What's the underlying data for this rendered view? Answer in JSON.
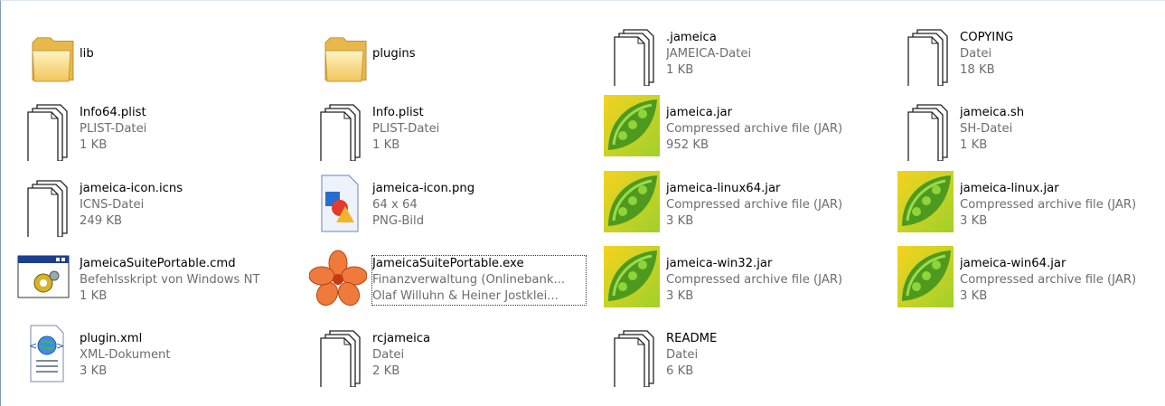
{
  "files": [
    {
      "name": "lib",
      "type": "",
      "size": "",
      "icon": "folder-icon"
    },
    {
      "name": "plugins",
      "type": "",
      "size": "",
      "icon": "folder-icon"
    },
    {
      "name": ".jameica",
      "type": "JAMEICA-Datei",
      "size": "1 KB",
      "icon": "generic-file-icon"
    },
    {
      "name": "COPYING",
      "type": "Datei",
      "size": "18 KB",
      "icon": "generic-file-icon"
    },
    {
      "name": "Info64.plist",
      "type": "PLIST-Datei",
      "size": "1 KB",
      "icon": "generic-file-icon"
    },
    {
      "name": "Info.plist",
      "type": "PLIST-Datei",
      "size": "1 KB",
      "icon": "generic-file-icon"
    },
    {
      "name": "jameica.jar",
      "type": "Compressed archive file (JAR)",
      "size": "952 KB",
      "icon": "jar-icon"
    },
    {
      "name": "jameica.sh",
      "type": "SH-Datei",
      "size": "1 KB",
      "icon": "generic-file-icon"
    },
    {
      "name": "jameica-icon.icns",
      "type": "ICNS-Datei",
      "size": "249 KB",
      "icon": "generic-file-icon"
    },
    {
      "name": "jameica-icon.png",
      "type": "64 x 64",
      "size": "PNG-Bild",
      "icon": "png-image-icon"
    },
    {
      "name": "jameica-linux64.jar",
      "type": "Compressed archive file (JAR)",
      "size": "3 KB",
      "icon": "jar-icon"
    },
    {
      "name": "jameica-linux.jar",
      "type": "Compressed archive file (JAR)",
      "size": "3 KB",
      "icon": "jar-icon"
    },
    {
      "name": "JameicaSuitePortable.cmd",
      "type": "Befehlsskript von Windows NT",
      "size": "1 KB",
      "icon": "cmd-script-icon"
    },
    {
      "name": "JameicaSuitePortable.exe",
      "type": "Finanzverwaltung (Onlinebank...",
      "size": "Olaf Willuhn  & Heiner Jostklei...",
      "icon": "exe-flower-icon",
      "selected": true
    },
    {
      "name": "jameica-win32.jar",
      "type": "Compressed archive file (JAR)",
      "size": "3 KB",
      "icon": "jar-icon"
    },
    {
      "name": "jameica-win64.jar",
      "type": "Compressed archive file (JAR)",
      "size": "3 KB",
      "icon": "jar-icon"
    },
    {
      "name": "plugin.xml",
      "type": "XML-Dokument",
      "size": "3 KB",
      "icon": "xml-document-icon"
    },
    {
      "name": "rcjameica",
      "type": "Datei",
      "size": "2 KB",
      "icon": "generic-file-icon"
    },
    {
      "name": "README",
      "type": "Datei",
      "size": "6 KB",
      "icon": "generic-file-icon"
    }
  ]
}
